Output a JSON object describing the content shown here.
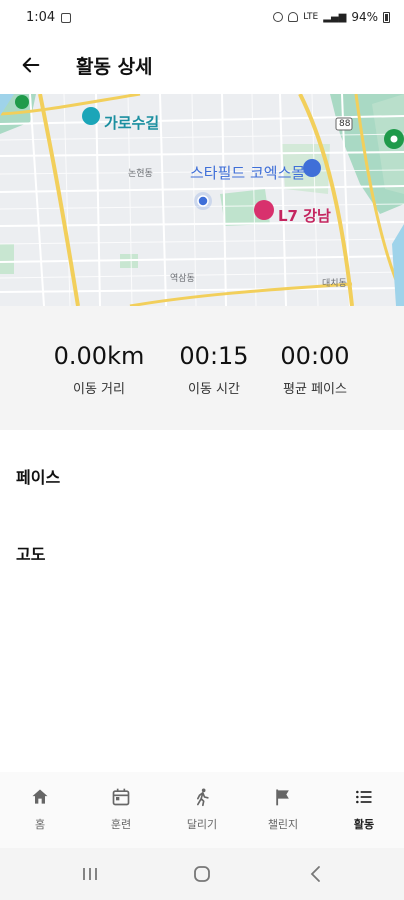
{
  "status_bar": {
    "time": "1:04",
    "battery_percent": "94%",
    "network": "LTE"
  },
  "app_bar": {
    "title": "활동 상세",
    "back_icon": "arrow-left-icon"
  },
  "map": {
    "labels": {
      "garosugil": "가로수길",
      "starfield": "스타필드 코엑스몰",
      "l7": "L7 강남",
      "nonhyeon": "논현동",
      "yeoksam": "역삼동",
      "daechi": "대치동",
      "road_number": "88"
    }
  },
  "stats": {
    "distance": {
      "value": "0.00km",
      "label": "이동 거리"
    },
    "time": {
      "value": "00:15",
      "label": "이동 시간"
    },
    "pace": {
      "value": "00:00",
      "label": "평균 페이스"
    }
  },
  "sections": {
    "pace_title": "페이스",
    "altitude_title": "고도"
  },
  "bottom_nav": {
    "items": [
      {
        "label": "홈",
        "icon": "home-icon"
      },
      {
        "label": "훈련",
        "icon": "calendar-icon"
      },
      {
        "label": "달리기",
        "icon": "runner-icon"
      },
      {
        "label": "챌린지",
        "icon": "flag-icon"
      },
      {
        "label": "활동",
        "icon": "list-icon"
      }
    ],
    "active_index": 4
  },
  "colors": {
    "accent": "#3f6fd8",
    "stats_background": "#f4f4f4"
  }
}
